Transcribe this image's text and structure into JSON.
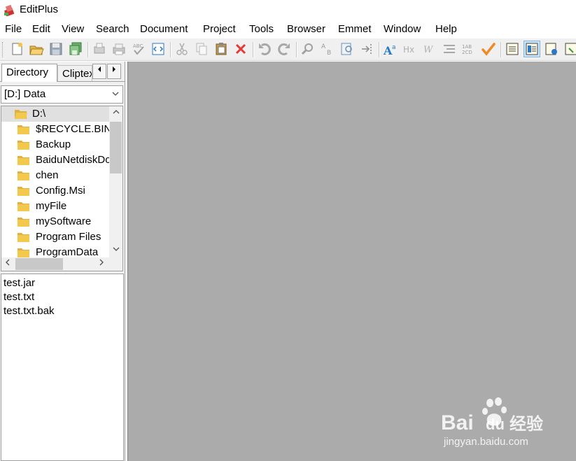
{
  "window": {
    "title": "EditPlus"
  },
  "menu": {
    "items": [
      "File",
      "Edit",
      "View",
      "Search",
      "Document",
      "Project",
      "Tools",
      "Browser",
      "Emmet",
      "Window",
      "Help"
    ]
  },
  "toolbar": {
    "buttons": [
      {
        "icon": "new-file-icon"
      },
      {
        "icon": "open-folder-icon"
      },
      {
        "icon": "save-icon"
      },
      {
        "icon": "save-all-icon"
      },
      {
        "icon": "print-preview-icon"
      },
      {
        "icon": "print-icon"
      },
      {
        "icon": "spell-check-icon"
      },
      {
        "icon": "browser-view-icon"
      },
      {
        "icon": "cut-icon"
      },
      {
        "icon": "copy-icon"
      },
      {
        "icon": "paste-icon"
      },
      {
        "icon": "delete-icon"
      },
      {
        "icon": "undo-icon"
      },
      {
        "icon": "redo-icon"
      },
      {
        "icon": "find-icon"
      },
      {
        "icon": "replace-icon"
      },
      {
        "icon": "find-in-files-icon"
      },
      {
        "icon": "goto-line-icon"
      },
      {
        "icon": "font-icon"
      },
      {
        "icon": "hex-icon"
      },
      {
        "icon": "word-wrap-icon"
      },
      {
        "icon": "line-number-icon"
      },
      {
        "icon": "column-icon"
      },
      {
        "icon": "checkmark-icon"
      },
      {
        "icon": "document-list-icon"
      },
      {
        "icon": "directory-window-icon"
      },
      {
        "icon": "output-window-icon"
      },
      {
        "icon": "cliptext-icon"
      }
    ]
  },
  "sidebar": {
    "tabs": [
      {
        "label": "Directory",
        "active": true
      },
      {
        "label": "Cliptext",
        "active": false
      }
    ],
    "drive": "[D:] Data",
    "tree": [
      {
        "label": "D:\\",
        "root": true
      },
      {
        "label": "$RECYCLE.BIN"
      },
      {
        "label": "Backup"
      },
      {
        "label": "BaiduNetdiskDownload"
      },
      {
        "label": "chen"
      },
      {
        "label": "Config.Msi"
      },
      {
        "label": "myFile"
      },
      {
        "label": "mySoftware"
      },
      {
        "label": "Program Files"
      },
      {
        "label": "ProgramData"
      }
    ],
    "files": [
      "test.jar",
      "test.txt",
      "test.txt.bak"
    ]
  },
  "watermark": {
    "brand_latin": "Bai",
    "brand_du": "du",
    "brand_cn": "经验",
    "url": "jingyan.baidu.com"
  },
  "colors": {
    "mdi_background": "#ababab",
    "folder_yellow": "#f2c94c",
    "accent_blue": "#2b79c6"
  }
}
